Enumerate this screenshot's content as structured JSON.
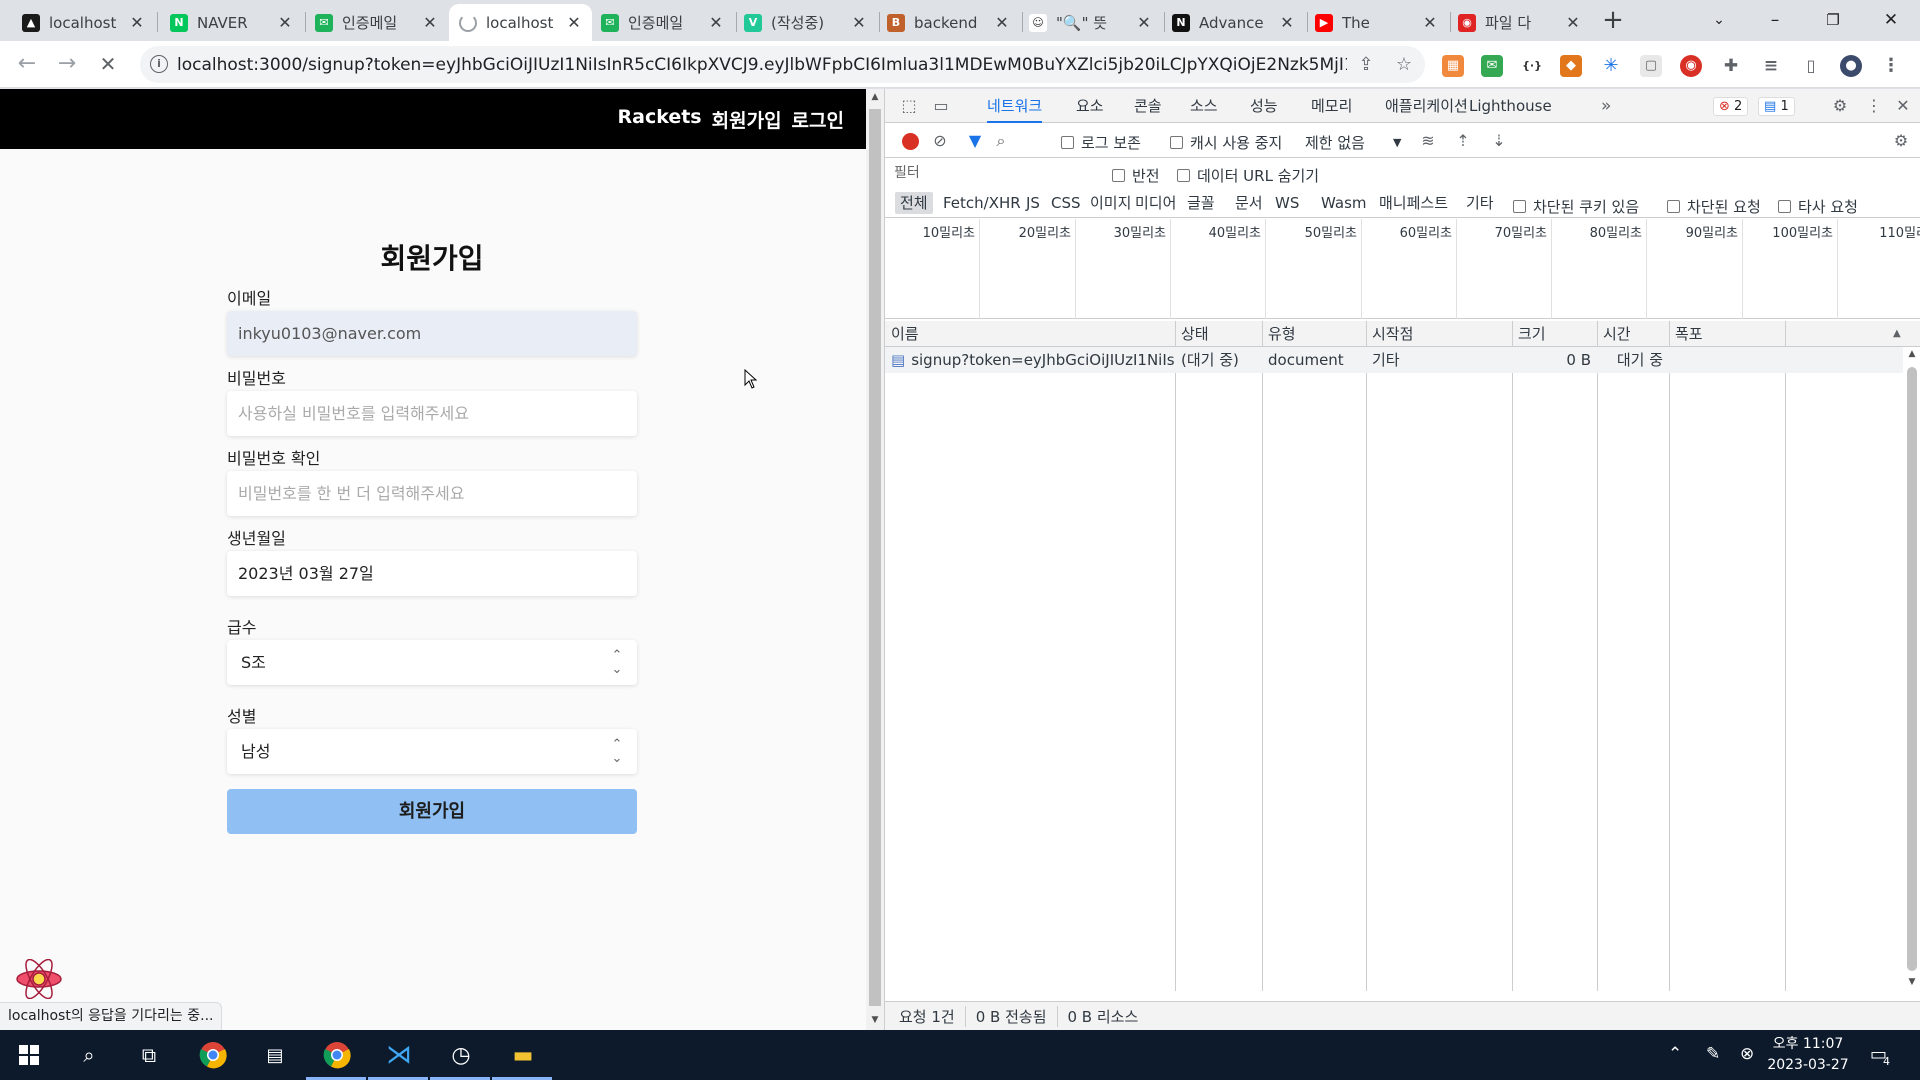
{
  "tabs": [
    {
      "label": "localhost",
      "fav_color": "#1a1a1a",
      "fav_glyph": "▲",
      "active": false
    },
    {
      "label": "NAVER",
      "fav_color": "#03c75a",
      "fav_glyph": "N",
      "active": false
    },
    {
      "label": "인증메일",
      "fav_color": "#1eb35a",
      "fav_glyph": "✉",
      "active": false
    },
    {
      "label": "localhost",
      "fav_color": "#ffffff",
      "fav_glyph": "",
      "active": true
    },
    {
      "label": "인증메일",
      "fav_color": "#1eb35a",
      "fav_glyph": "✉",
      "active": false
    },
    {
      "label": "(작성중)",
      "fav_color": "#20c997",
      "fav_glyph": "V",
      "active": false
    },
    {
      "label": "backend",
      "fav_color": "#c0602b",
      "fav_glyph": "B",
      "active": false
    },
    {
      "label": "\"🔍\" 뜻",
      "fav_color": "#ffffff",
      "fav_glyph": "☺",
      "active": false
    },
    {
      "label": "Advance",
      "fav_color": "#111111",
      "fav_glyph": "N",
      "active": false
    },
    {
      "label": "The",
      "fav_color": "#ff0000",
      "fav_glyph": "▶",
      "active": false
    },
    {
      "label": "파일 다",
      "fav_color": "#e02424",
      "fav_glyph": "◉",
      "active": false
    }
  ],
  "address": {
    "url": "localhost:3000/signup?token=eyJhbGciOiJIUzI1NiIsInR5cCI6IkpXVCJ9.eyJlbWFpbCI6Imlua3l1MDEwM0BuYXZlci5jb20iLCJpYXQiOjE2Nzk5MjI1NDks..."
  },
  "app": {
    "brand": "Rackets",
    "nav_signup": "회원가입",
    "nav_login": "로그인"
  },
  "form": {
    "title": "회원가입",
    "email_label": "이메일",
    "email_value": "inkyu0103@naver.com",
    "password_label": "비밀번호",
    "password_placeholder": "사용하실 비밀번호를 입력해주세요",
    "confirm_label": "비밀번호 확인",
    "confirm_placeholder": "비밀번호를 한 번 더 입력해주세요",
    "birth_label": "생년월일",
    "birth_value": "2023년 03월 27일",
    "grade_label": "급수",
    "grade_value": "S조",
    "gender_label": "성별",
    "gender_value": "남성",
    "submit_label": "회원가입"
  },
  "status_text": "localhost의 응답을 기다리는 중...",
  "devtools": {
    "tabs": [
      "네트워크",
      "요소",
      "콘솔",
      "소스",
      "성능",
      "메모리",
      "애플리케이션",
      "Lighthouse"
    ],
    "errors": "2",
    "messages": "1",
    "preserve_log": "로그 보존",
    "disable_cache": "캐시 사용 중지",
    "throttle": "제한 없음",
    "filter_placeholder": "필터",
    "invert": "반전",
    "hide_data_urls": "데이터 URL 숨기기",
    "filter_types": [
      "전체",
      "Fetch/XHR",
      "JS",
      "CSS",
      "이미지",
      "미디어",
      "글꼴",
      "문서",
      "WS",
      "Wasm",
      "매니페스트",
      "기타"
    ],
    "blocked_cookies": "차단된 쿠키 있음",
    "blocked_requests": "차단된 요청",
    "third_party": "타사 요청",
    "timeline_ticks": [
      "10밀리초",
      "20밀리초",
      "30밀리초",
      "40밀리초",
      "50밀리초",
      "60밀리초",
      "70밀리초",
      "80밀리초",
      "90밀리초",
      "100밀리초",
      "110밀리"
    ],
    "columns": [
      "이름",
      "상태",
      "유형",
      "시작점",
      "크기",
      "시간",
      "폭포"
    ],
    "row": {
      "name": "signup?token=eyJhbGciOiJIUzI1NiIsI...",
      "status": "(대기 중)",
      "type": "document",
      "initiator": "기타",
      "size": "0 B",
      "time": "대기 중"
    },
    "summary_requests": "요청 1건",
    "summary_transferred": "0 B 전송됨",
    "summary_resources": "0 B 리소스"
  },
  "taskbar": {
    "time": "오후 11:07",
    "date": "2023-03-27",
    "notifications": "4"
  },
  "colors": {
    "accent": "#1a73e8",
    "submit_bg": "#90c0f3",
    "record": "#d93025"
  }
}
